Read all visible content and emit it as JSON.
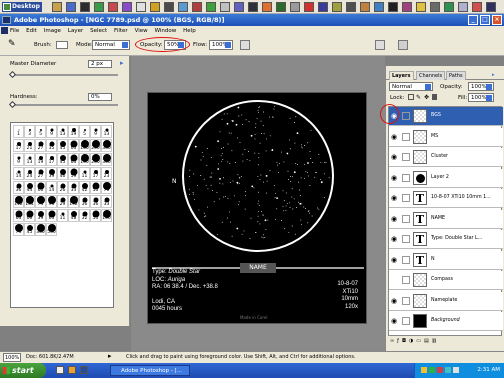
{
  "desktop_bar": {
    "label": "Desktop"
  },
  "titlebar": {
    "title": "Adobe Photoshop - [NGC 7789.psd @ 100% (BGS, RGB/8)]"
  },
  "menu": [
    "File",
    "Edit",
    "Image",
    "Layer",
    "Select",
    "Filter",
    "View",
    "Window",
    "Help"
  ],
  "options": {
    "brush_label": "Brush:",
    "mode_label": "Mode:",
    "mode_value": "Normal",
    "opacity_label": "Opacity:",
    "opacity_value": "50%",
    "flow_label": "Flow:",
    "flow_value": "100%"
  },
  "brush_panel": {
    "master_diameter_label": "Master Diameter",
    "master_diameter_value": "2 px",
    "hardness_label": "Hardness:",
    "hardness_value": "0%",
    "brushes": [
      "1",
      "3",
      "5",
      "9",
      "13",
      "19",
      "5",
      "9",
      "13",
      "17",
      "21",
      "27",
      "35",
      "45",
      "65",
      "100",
      "200",
      "300",
      "9",
      "13",
      "19",
      "17",
      "45",
      "65",
      "100",
      "200",
      "300",
      "14",
      "24",
      "27",
      "39",
      "46",
      "59",
      "11",
      "17",
      "23",
      "36",
      "44",
      "60",
      "14",
      "26",
      "33",
      "42",
      "55",
      "70",
      "112",
      "134",
      "74",
      "95",
      "29",
      "192",
      "36",
      "36",
      "33",
      "63",
      "66",
      "39",
      "63",
      "11",
      "48",
      "32",
      "55",
      "100",
      "75",
      "45",
      "300",
      "500"
    ]
  },
  "canvas": {
    "n_label": "N",
    "name_badge": "NAME",
    "type_label": "Type:",
    "type_value": "Double Star",
    "loc_label": "LOC:",
    "loc_value": "Auriga",
    "radec": "RA:  06 38.4 / Dec. +38.8",
    "place": "Lodi, CA",
    "hours": "0045 hours",
    "date": "10-8-07",
    "scope": "XTi10",
    "eyepiece": "10mm",
    "mag": "120x",
    "watermark": "Made in Corel"
  },
  "layers_panel": {
    "tabs": [
      "Layers",
      "Channels",
      "Paths"
    ],
    "blend_mode": "Normal",
    "opacity_label": "Opacity:",
    "opacity_value": "100%",
    "lock_label": "Lock:",
    "fill_label": "Fill:",
    "fill_value": "100%",
    "layers": [
      {
        "name": "BGS",
        "thumb": "checker",
        "selected": true,
        "visible": true
      },
      {
        "name": "MS",
        "thumb": "checker",
        "selected": false,
        "visible": true
      },
      {
        "name": "Cluster",
        "thumb": "checker",
        "selected": false,
        "visible": true
      },
      {
        "name": "Layer 2",
        "thumb": "circle",
        "selected": false,
        "visible": true
      },
      {
        "name": "10-8-07 XTi10 10mm 1...",
        "thumb": "text",
        "selected": false,
        "visible": true
      },
      {
        "name": "NAME",
        "thumb": "text",
        "selected": false,
        "visible": true
      },
      {
        "name": "Type: Double Star L...",
        "thumb": "text",
        "selected": false,
        "visible": true
      },
      {
        "name": "N",
        "thumb": "text",
        "selected": false,
        "visible": true
      },
      {
        "name": "Compass",
        "thumb": "checker",
        "selected": false,
        "visible": false
      },
      {
        "name": "Nameplate",
        "thumb": "checker",
        "selected": false,
        "visible": true
      },
      {
        "name": "Background",
        "thumb": "black",
        "selected": false,
        "visible": true,
        "italic": true
      }
    ]
  },
  "status_bar": {
    "zoom": "100%",
    "doc": "Doc: 601.8K/2.47M",
    "hint": "Click and drag to paint using foreground color.  Use Shift, Alt, and Ctrl for additional options."
  },
  "taskbar": {
    "start": "start",
    "task": "Adobe Photoshop - [...",
    "clock": "2:31 AM"
  }
}
